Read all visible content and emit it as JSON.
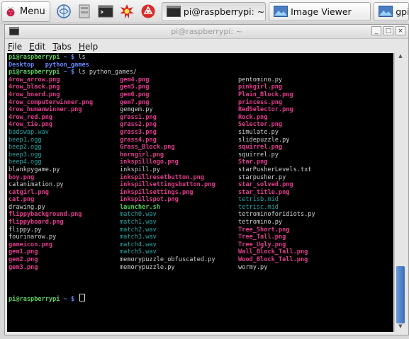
{
  "taskbar": {
    "menu_label": "Menu",
    "launchers": [
      "browser-icon",
      "file-manager-icon",
      "terminal-icon",
      "math-icon",
      "wolfram-icon"
    ],
    "tasks": [
      {
        "label": "pi@raspberrypi: ~",
        "icon": "terminal-icon",
        "active": true
      },
      {
        "label": "Image Viewer",
        "icon": "image-viewer-icon",
        "active": false
      },
      {
        "label": "gpic",
        "icon": "gpicview-icon",
        "active": false
      }
    ]
  },
  "window": {
    "title": "pi@raspberrypi: ~",
    "controls": [
      "_",
      "□",
      "×"
    ],
    "menu": [
      {
        "pre": "",
        "key": "F",
        "post": "ile"
      },
      {
        "pre": "",
        "key": "E",
        "post": "dit"
      },
      {
        "pre": "",
        "key": "T",
        "post": "abs"
      },
      {
        "pre": "",
        "key": "H",
        "post": "elp"
      }
    ]
  },
  "terminal": {
    "prompt": "pi@raspberrypi",
    "prompt_suffix": " ~ $ ",
    "cmd1": "ls",
    "home_listing": [
      "Desktop",
      "python_games"
    ],
    "cmd2": "ls python_games/",
    "columns": [
      [
        {
          "name": "4row_arrow.png",
          "kind": "img"
        },
        {
          "name": "4row_black.png",
          "kind": "img"
        },
        {
          "name": "4row_board.png",
          "kind": "img"
        },
        {
          "name": "4row_computerwinner.png",
          "kind": "img"
        },
        {
          "name": "4row_humanwinner.png",
          "kind": "img"
        },
        {
          "name": "4row_red.png",
          "kind": "img"
        },
        {
          "name": "4row_tie.png",
          "kind": "img"
        },
        {
          "name": "badswap.wav",
          "kind": "aud"
        },
        {
          "name": "beep1.ogg",
          "kind": "aud"
        },
        {
          "name": "beep2.ogg",
          "kind": "aud"
        },
        {
          "name": "beep3.ogg",
          "kind": "aud"
        },
        {
          "name": "beep4.ogg",
          "kind": "aud"
        },
        {
          "name": "blankpygame.py",
          "kind": "py"
        },
        {
          "name": "boy.png",
          "kind": "img"
        },
        {
          "name": "catanimation.py",
          "kind": "py"
        },
        {
          "name": "catgirl.png",
          "kind": "img"
        },
        {
          "name": "cat.png",
          "kind": "img"
        },
        {
          "name": "drawing.py",
          "kind": "py"
        },
        {
          "name": "flippybackground.png",
          "kind": "img"
        },
        {
          "name": "flippyboard.png",
          "kind": "img"
        },
        {
          "name": "flippy.py",
          "kind": "py"
        },
        {
          "name": "fourinarow.py",
          "kind": "py"
        },
        {
          "name": "gameicon.png",
          "kind": "img"
        },
        {
          "name": "gem1.png",
          "kind": "img"
        },
        {
          "name": "gem2.png",
          "kind": "img"
        },
        {
          "name": "gem3.png",
          "kind": "img"
        }
      ],
      [
        {
          "name": "gem4.png",
          "kind": "img"
        },
        {
          "name": "gem5.png",
          "kind": "img"
        },
        {
          "name": "gem6.png",
          "kind": "img"
        },
        {
          "name": "gem7.png",
          "kind": "img"
        },
        {
          "name": "gemgem.py",
          "kind": "py"
        },
        {
          "name": "grass1.png",
          "kind": "img"
        },
        {
          "name": "grass2.png",
          "kind": "img"
        },
        {
          "name": "grass3.png",
          "kind": "img"
        },
        {
          "name": "grass4.png",
          "kind": "img"
        },
        {
          "name": "Grass_Block.png",
          "kind": "img"
        },
        {
          "name": "horngirl.png",
          "kind": "img"
        },
        {
          "name": "inkspilllogo.png",
          "kind": "img"
        },
        {
          "name": "inkspill.py",
          "kind": "py"
        },
        {
          "name": "inkspillresetbutton.png",
          "kind": "img"
        },
        {
          "name": "inkspillsettingsbutton.png",
          "kind": "img"
        },
        {
          "name": "inkspillsettings.png",
          "kind": "img"
        },
        {
          "name": "inkspillspot.png",
          "kind": "img"
        },
        {
          "name": "launcher.sh",
          "kind": "sh"
        },
        {
          "name": "match0.wav",
          "kind": "aud"
        },
        {
          "name": "match1.wav",
          "kind": "aud"
        },
        {
          "name": "match2.wav",
          "kind": "aud"
        },
        {
          "name": "match3.wav",
          "kind": "aud"
        },
        {
          "name": "match4.wav",
          "kind": "aud"
        },
        {
          "name": "match5.wav",
          "kind": "aud"
        },
        {
          "name": "memorypuzzle_obfuscated.py",
          "kind": "py"
        },
        {
          "name": "memorypuzzle.py",
          "kind": "py"
        }
      ],
      [
        {
          "name": "pentomino.py",
          "kind": "py"
        },
        {
          "name": "pinkgirl.png",
          "kind": "img"
        },
        {
          "name": "Plain_Block.png",
          "kind": "img"
        },
        {
          "name": "princess.png",
          "kind": "img"
        },
        {
          "name": "RedSelector.png",
          "kind": "img"
        },
        {
          "name": "Rock.png",
          "kind": "img"
        },
        {
          "name": "Selector.png",
          "kind": "img"
        },
        {
          "name": "simulate.py",
          "kind": "py"
        },
        {
          "name": "slidepuzzle.py",
          "kind": "py"
        },
        {
          "name": "squirrel.png",
          "kind": "img"
        },
        {
          "name": "squirrel.py",
          "kind": "py"
        },
        {
          "name": "Star.png",
          "kind": "img"
        },
        {
          "name": "starPusherLevels.txt",
          "kind": "py"
        },
        {
          "name": "starpusher.py",
          "kind": "py"
        },
        {
          "name": "star_solved.png",
          "kind": "img"
        },
        {
          "name": "star_title.png",
          "kind": "img"
        },
        {
          "name": "tetrisb.mid",
          "kind": "aud"
        },
        {
          "name": "tetrisc.mid",
          "kind": "aud"
        },
        {
          "name": "tetrominoforidiots.py",
          "kind": "py"
        },
        {
          "name": "tetromino.py",
          "kind": "py"
        },
        {
          "name": "Tree_Short.png",
          "kind": "img"
        },
        {
          "name": "Tree_Tall.png",
          "kind": "img"
        },
        {
          "name": "Tree_Ugly.png",
          "kind": "img"
        },
        {
          "name": "Wall_Block_Tall.png",
          "kind": "img"
        },
        {
          "name": "Wood_Block_Tall.png",
          "kind": "img"
        },
        {
          "name": "wormy.py",
          "kind": "py"
        }
      ]
    ]
  },
  "colors": {
    "prompt": "#5fd05f",
    "directory": "#6a86ff",
    "image_file": "#e23c8e",
    "audio_file": "#26a5a5",
    "text_file": "#cfcfcf",
    "executable": "#55d055"
  }
}
